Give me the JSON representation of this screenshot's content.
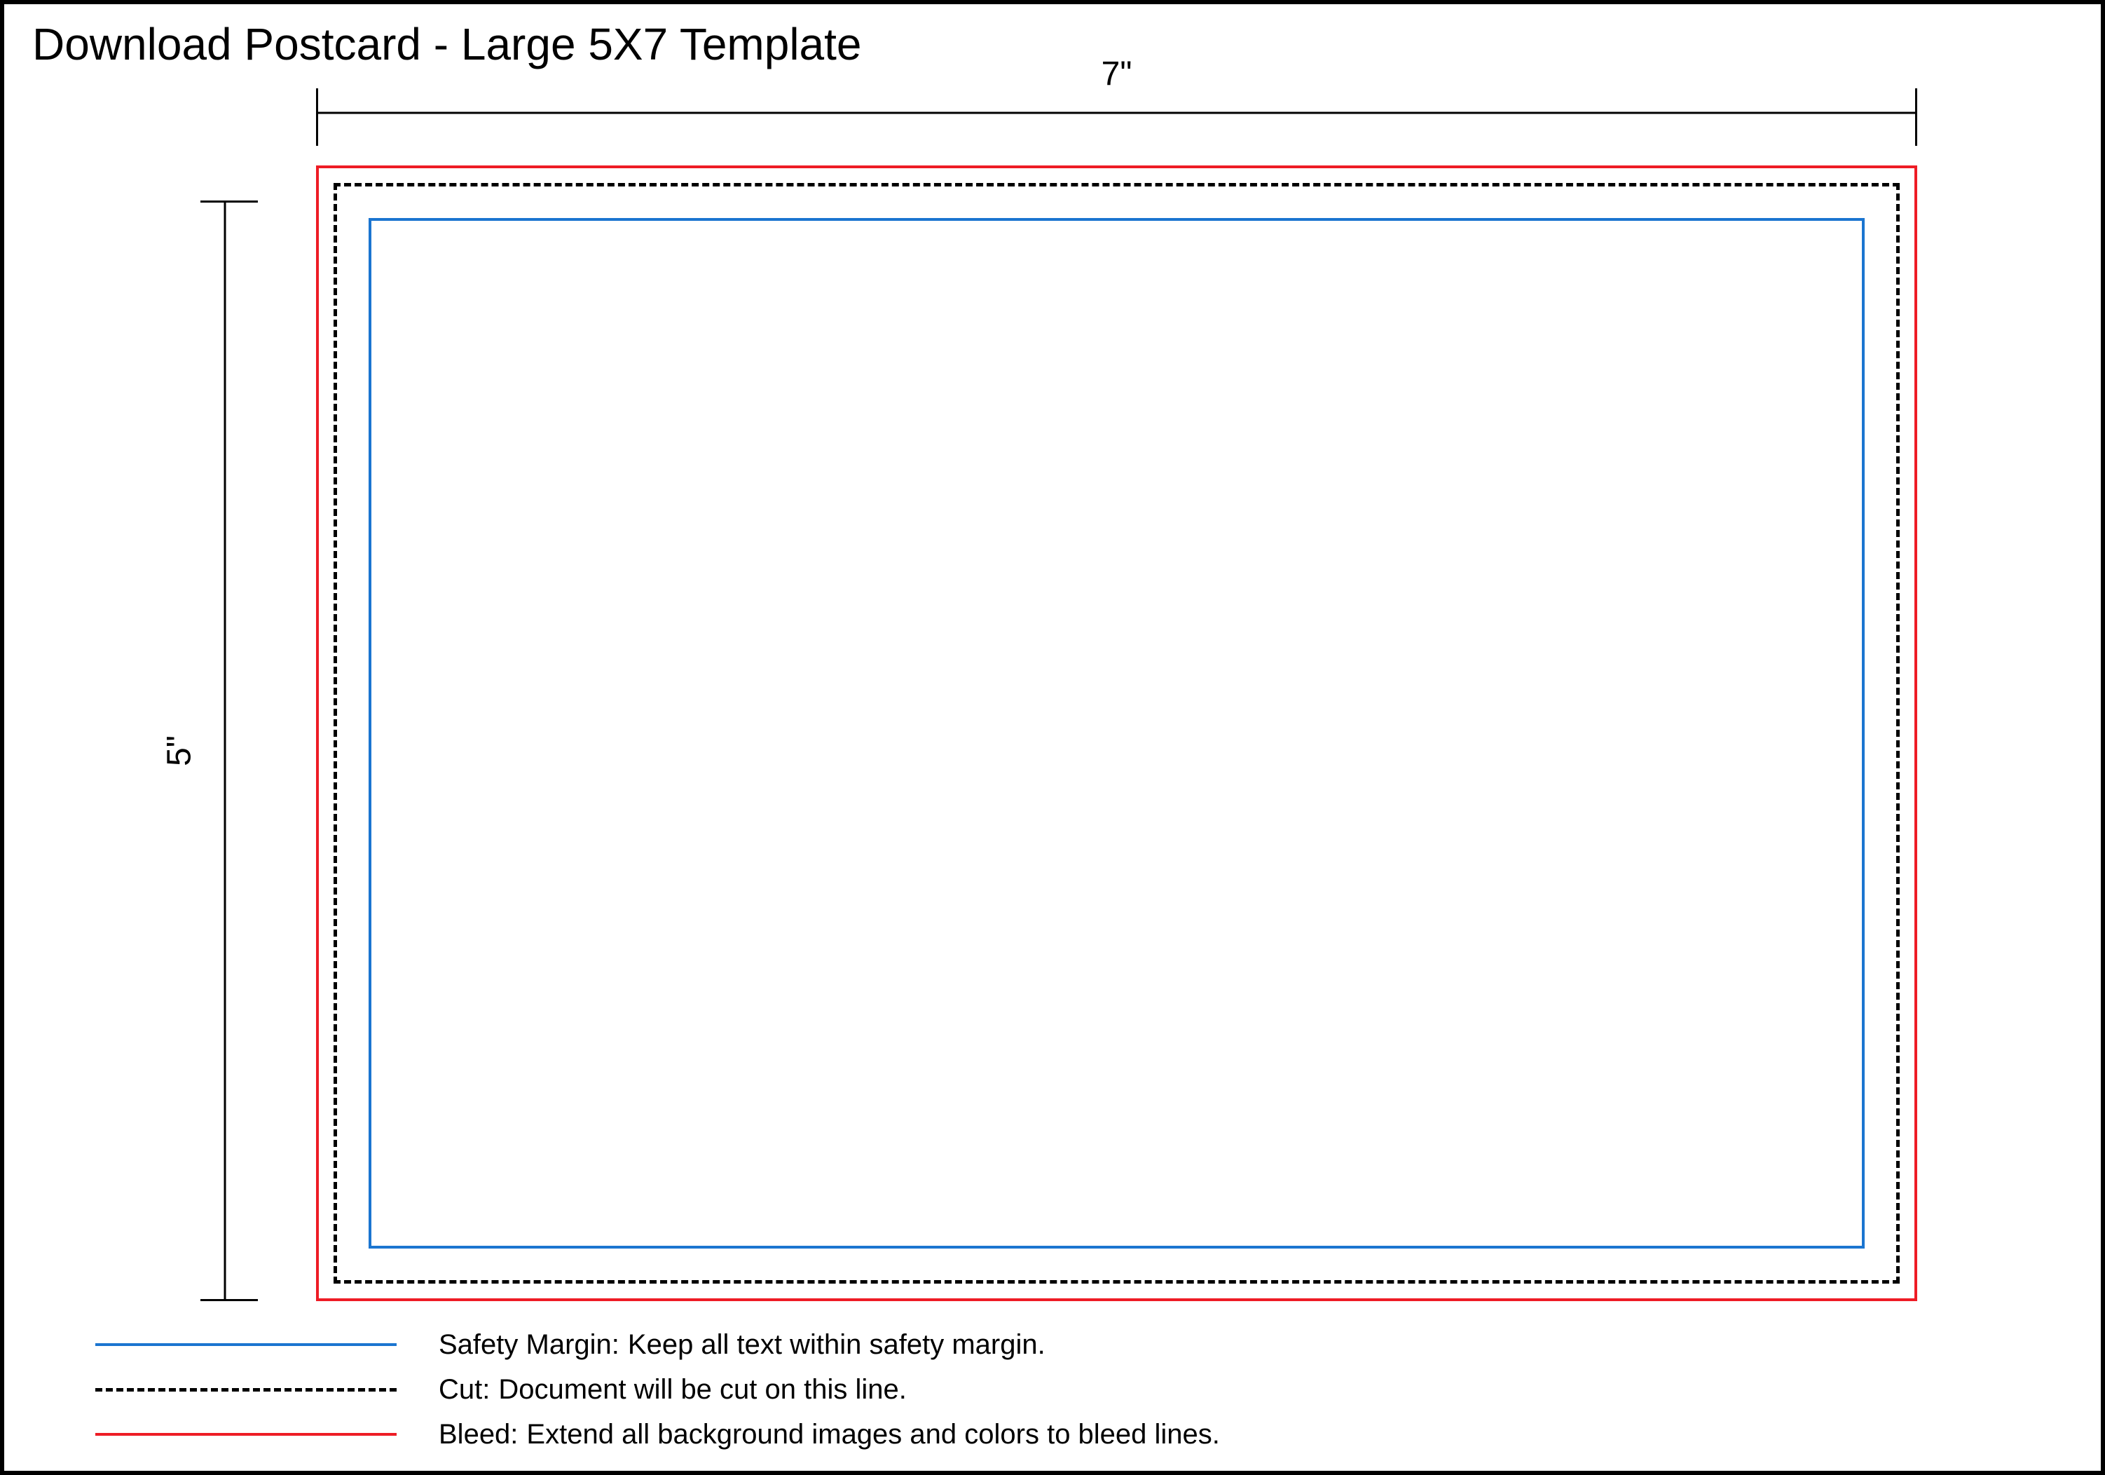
{
  "title": "Download Postcard - Large 5X7 Template",
  "dimensions": {
    "width_label": "7\"",
    "height_label": "5\""
  },
  "colors": {
    "bleed": "#ee1c25",
    "cut": "#000000",
    "safety": "#1b75d0"
  },
  "legend": {
    "safety": {
      "name": "Safety Margin:",
      "desc": "Keep all text within safety margin."
    },
    "cut": {
      "name": "Cut:",
      "desc": "Document will be cut on this line."
    },
    "bleed": {
      "name": "Bleed:",
      "desc": "Extend all background images and colors to bleed lines."
    }
  }
}
